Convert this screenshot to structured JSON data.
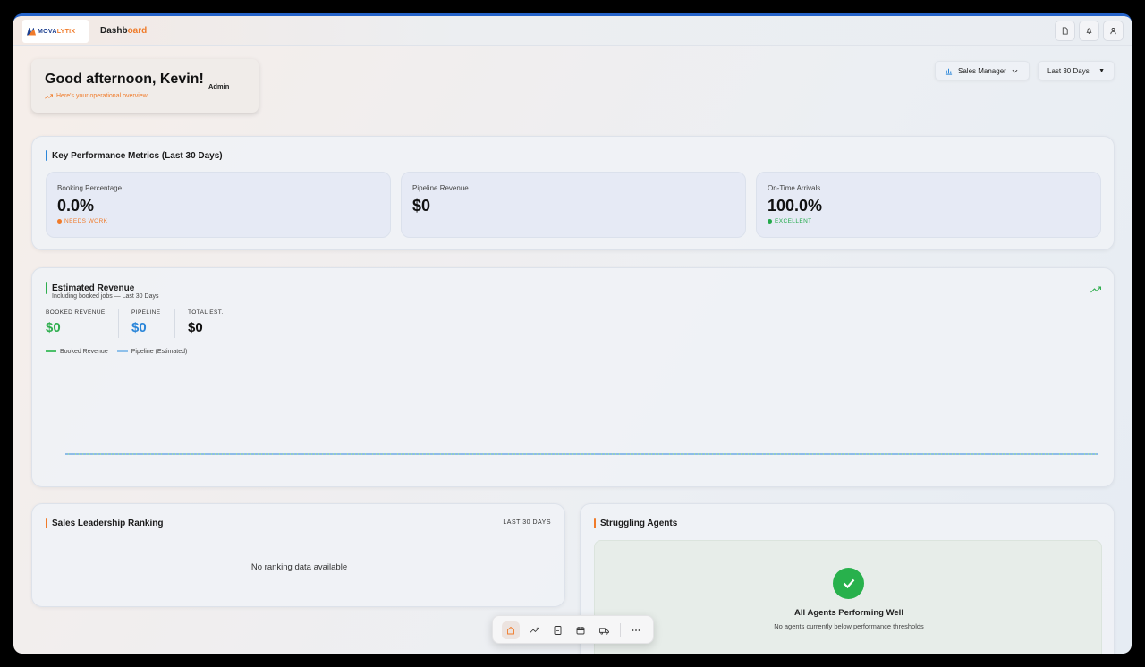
{
  "app": {
    "logo_text_a": "MOVA",
    "logo_text_b": "LYTIX",
    "title_a": "Dashb",
    "title_b": "oard"
  },
  "greeting": {
    "headline": "Good afternoon, Kevin!",
    "subtitle": "Here's your operational overview",
    "role_badge": "Admin"
  },
  "filters": {
    "role_selector": "Sales Manager",
    "date_range": "Last 30 Days"
  },
  "kpi": {
    "title": "Key Performance Metrics (Last 30 Days)",
    "cards": [
      {
        "label": "Booking Percentage",
        "value": "0.0%",
        "status": "NEEDS WORK",
        "status_color": "#f07b2a"
      },
      {
        "label": "Pipeline Revenue",
        "value": "$0",
        "status": "",
        "status_color": ""
      },
      {
        "label": "On-Time Arrivals",
        "value": "100.0%",
        "status": "EXCELLENT",
        "status_color": "#22a94a"
      }
    ]
  },
  "revenue": {
    "title": "Estimated Revenue",
    "subtitle": "Including booked jobs — Last 30 Days",
    "stats": [
      {
        "label": "BOOKED REVENUE",
        "value": "$0",
        "color": "#2fae4e"
      },
      {
        "label": "PIPELINE",
        "value": "$0",
        "color": "#2b86d9"
      },
      {
        "label": "TOTAL EST.",
        "value": "$0",
        "color": "#111111"
      }
    ],
    "legend": [
      {
        "name": "Booked Revenue",
        "color": "#4cc06a"
      },
      {
        "name": "Pipeline (Estimated)",
        "color": "#8ec0ea"
      }
    ]
  },
  "chart_data": {
    "type": "line",
    "series": [
      {
        "name": "Booked Revenue",
        "values": [
          0,
          0
        ]
      },
      {
        "name": "Pipeline (Estimated)",
        "values": [
          0,
          0
        ]
      }
    ]
  },
  "ranking": {
    "title": "Sales Leadership Ranking",
    "period": "LAST 30 DAYS",
    "empty": "No ranking data available"
  },
  "struggling": {
    "title": "Struggling Agents",
    "headline": "All Agents Performing Well",
    "message": "No agents currently below performance thresholds"
  },
  "colors": {
    "accent_orange": "#f07b2a",
    "accent_blue": "#2563c9",
    "success_green": "#22a94a"
  },
  "bottom_nav": [
    "home-icon",
    "trend-icon",
    "document-icon",
    "calendar-icon",
    "truck-icon",
    "more-icon"
  ]
}
